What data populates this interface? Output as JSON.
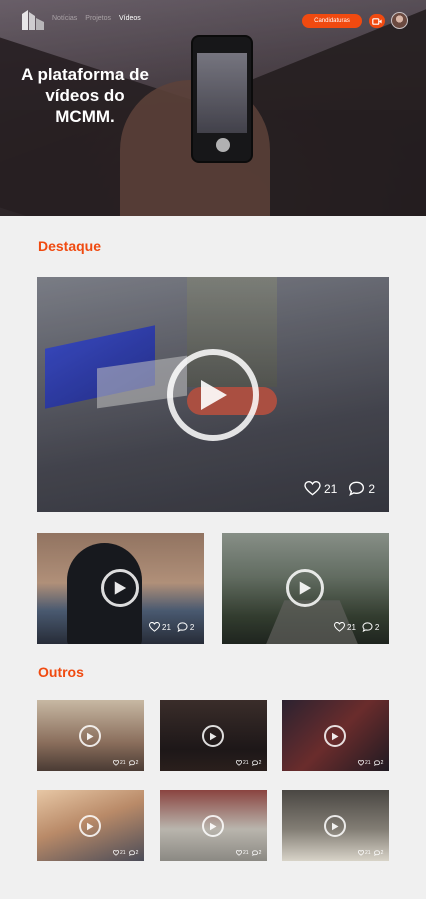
{
  "header": {
    "logo_icon": "mcmm-logo-icon",
    "nav": [
      {
        "label": "Notícias",
        "active": false
      },
      {
        "label": "Projetos",
        "active": false
      },
      {
        "label": "Vídeos",
        "active": true
      }
    ],
    "cta_label": "Candidaturas",
    "camera_icon": "video-camera-icon",
    "accent_color": "#f04a10"
  },
  "hero": {
    "title": "A plataforma de vídeos do MCMM."
  },
  "featured": {
    "title": "Destaque",
    "main": {
      "likes": "21",
      "comments": "2"
    },
    "secondary": [
      {
        "likes": "21",
        "comments": "2"
      },
      {
        "likes": "21",
        "comments": "2"
      }
    ]
  },
  "others": {
    "title": "Outros",
    "items": [
      {
        "likes": "21",
        "comments": "2"
      },
      {
        "likes": "21",
        "comments": "2"
      },
      {
        "likes": "21",
        "comments": "2"
      },
      {
        "likes": "21",
        "comments": "2"
      },
      {
        "likes": "21",
        "comments": "2"
      },
      {
        "likes": "21",
        "comments": "2"
      }
    ]
  }
}
